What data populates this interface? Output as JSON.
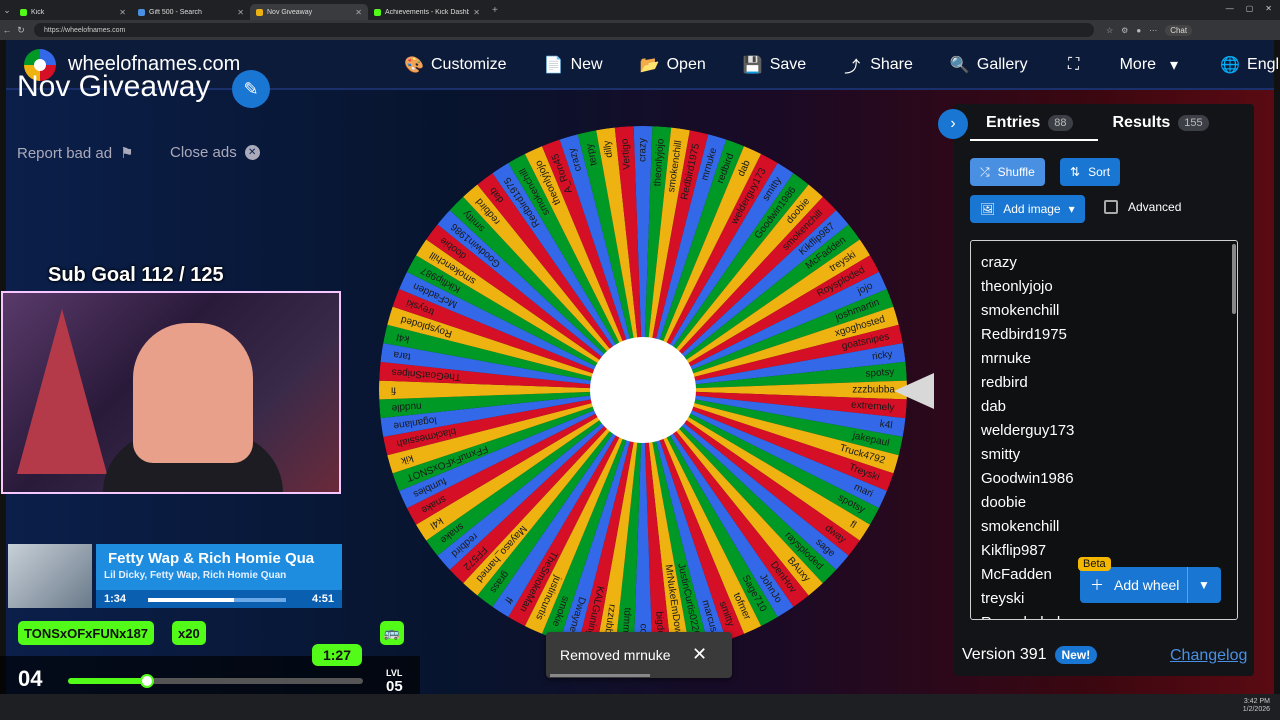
{
  "browser": {
    "tabs": [
      {
        "label": "Kick",
        "active": false
      },
      {
        "label": "Gift 500 - Search",
        "active": false
      },
      {
        "label": "Nov Giveaway",
        "active": true
      },
      {
        "label": "Achievements - Kick Dashboard",
        "active": false
      }
    ],
    "url": "https://wheelofnames.com",
    "chat_label": "Chat"
  },
  "site": {
    "name": "wheelofnames.com",
    "menu": [
      {
        "label": "Customize",
        "icon": "palette-icon",
        "glyph": "🎨"
      },
      {
        "label": "New",
        "icon": "new-file-icon",
        "glyph": "📄"
      },
      {
        "label": "Open",
        "icon": "folder-icon",
        "glyph": "📂"
      },
      {
        "label": "Save",
        "icon": "save-icon",
        "glyph": "💾"
      },
      {
        "label": "Share",
        "icon": "share-icon",
        "glyph": "⤴"
      },
      {
        "label": "Gallery",
        "icon": "search-icon",
        "glyph": "🔍"
      },
      {
        "label": "",
        "icon": "fullscreen-icon",
        "glyph": "⛶"
      },
      {
        "label": "More",
        "icon": "caret-down-icon",
        "glyph": "▾"
      },
      {
        "label": "English",
        "icon": "globe-icon",
        "glyph": "🌐"
      }
    ]
  },
  "left": {
    "title": "Nov Giveaway",
    "report_bad_ad": "Report bad ad",
    "close_ads": "Close ads"
  },
  "overlay": {
    "sub_goal": "Sub Goal  112 / 125",
    "song_title": "Fetty Wap & Rich Homie Qua",
    "song_artist": "Lil Dicky, Fetty Wap, Rich Homie Quan",
    "time_current": "1:34",
    "time_total": "4:51",
    "progress": 0.62,
    "username_tag": "TONSxOFxFUNx187",
    "multiplier": "x20",
    "timer": "1:27",
    "level": "04",
    "xp": "80",
    "xp_fraction": 0.26,
    "lvl_label": "LVL",
    "next_level": "05"
  },
  "wheel": {
    "colors": [
      "#3369e8",
      "#009925",
      "#eeb211",
      "#d50f25"
    ],
    "labels": [
      "crazy",
      "theonlyjojo",
      "smokenchill",
      "Redbird1975",
      "mrnuke",
      "redbird",
      "dab",
      "welderguy173",
      "smitty",
      "Goodwin1986",
      "doobie",
      "smokenchill",
      "Kikflip987",
      "McFadden",
      "treyski",
      "Roysploded",
      "jojo",
      "joshmartin",
      "xgoghosted",
      "goatsnipes",
      "ricky",
      "spotsy",
      "zzzbubba",
      "extremely",
      "k4l",
      "jakepaul",
      "Truck4792",
      "Treyski",
      "mari",
      "spotsy",
      "fl",
      "dway",
      "sage",
      "raysploded",
      "BAuxy",
      "DenHov",
      "JohnJo",
      "Sage710",
      "tofmer",
      "smitty",
      "marcus",
      "JustinCurtis0226",
      "MrNukeEmDown",
      "bigdog",
      "codi",
      "tdmmer",
      "rzzubba",
      "KALGuning",
      "Dwayne",
      "smokie",
      "justincurtis",
      "TheSmokeMan",
      "ff",
      "grass",
      "Mayaso_hamed",
      "FF572",
      "redbird",
      "snake",
      "k4l",
      "snake",
      "fumbles",
      "FFxnuFxFOxSNOT",
      "kik",
      "blackmessiah",
      "loganlane",
      "nuddle",
      "fi",
      "TheGoatSnipes",
      "tara",
      "k4l",
      "Roysploded",
      "treyski",
      "McFadden",
      "Kikflip987",
      "smokenchill",
      "doobie",
      "Goodwin1986",
      "smitty",
      "redbird",
      "dab",
      "Redbird1975",
      "smokenchill",
      "theonlyjojo",
      "A_Ron45",
      "crazy",
      "terpy",
      "dilly",
      "Vertigo"
    ]
  },
  "toast": {
    "message": "Removed mrnuke"
  },
  "panel": {
    "tab_entries": "Entries",
    "entries_count": "88",
    "tab_results": "Results",
    "results_count": "155",
    "shuffle": "Shuffle",
    "sort": "Sort",
    "add_image": "Add image",
    "advanced": "Advanced",
    "entries": [
      "crazy",
      "theonlyjojo",
      "smokenchill",
      "Redbird1975",
      "mrnuke",
      "redbird",
      "dab",
      "welderguy173",
      "smitty",
      "Goodwin1986",
      "doobie",
      "smokenchill",
      "Kikflip987",
      "McFadden",
      "treyski",
      "Roysploded"
    ],
    "beta": "Beta",
    "add_wheel": "Add wheel",
    "version": "Version 391",
    "new_badge": "New!",
    "changelog": "Changelog"
  },
  "taskbar": {
    "time": "3:42 PM",
    "date": "1/2/2026"
  }
}
